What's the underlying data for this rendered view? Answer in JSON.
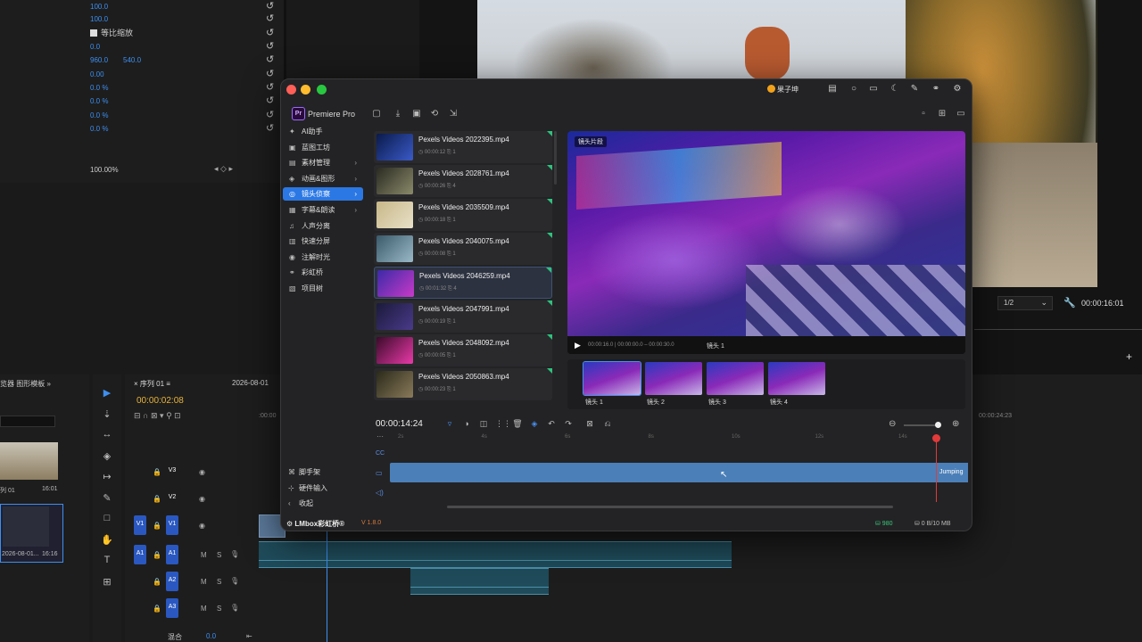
{
  "effect_controls": {
    "rows": [
      {
        "v1": "100.0",
        "v2": ""
      },
      {
        "v1": "100.0",
        "v2": ""
      },
      {
        "v1": "",
        "v2": ""
      },
      {
        "v1": "0.0",
        "v2": ""
      },
      {
        "v1": "960.0",
        "v2": "540.0"
      },
      {
        "v1": "0.00",
        "v2": ""
      },
      {
        "v1": "0.0 %",
        "v2": ""
      },
      {
        "v1": "0.0 %",
        "v2": ""
      },
      {
        "v1": "0.0 %",
        "v2": ""
      },
      {
        "v1": "0.0 %",
        "v2": ""
      }
    ],
    "uniform_scale_label": "等比缩放",
    "percent": "100.00%",
    "reset_glyph": "↺",
    "nav_glyph": "◂ ◇ ▸"
  },
  "program": {
    "zoom": "1/2",
    "timecode": "00:00:16:01",
    "plus": "+"
  },
  "project": {
    "tabs": "览器       图形模板  »",
    "items": [
      {
        "name": "列 01",
        "duration": "16:01"
      },
      {
        "name": "2026-08-01...",
        "duration": "16:16"
      }
    ]
  },
  "timeline": {
    "tab_label": "×  序列 01  ≡",
    "tab2_label": "2026-08-01",
    "timecode": "00:00:02:08",
    "tool_glyphs": "⊟ ∩ ⊠ ▾ ⚲ ⊡",
    "ruler_tc": ":00:00",
    "right_tc": "00:00:24:23",
    "video_tracks": [
      {
        "label": "V3"
      },
      {
        "label": "V2"
      },
      {
        "label": "V1"
      }
    ],
    "audio_tracks": [
      {
        "label": "A1"
      },
      {
        "label": "A2"
      },
      {
        "label": "A3"
      }
    ],
    "m_label": "M",
    "s_label": "S",
    "v1_src": "V1",
    "a1_src": "A1",
    "lock_glyph": "🔒",
    "eye_glyph": "◉",
    "mic_glyph": "🎙",
    "mix_label": "混合",
    "mix_value": "0.0",
    "mix_end": "⇤"
  },
  "tools": [
    "▶",
    "⇣",
    "↔",
    "◈",
    "↦",
    "✎",
    "□",
    "✋",
    "T",
    "⊞"
  ],
  "plugin": {
    "user": "果子坤",
    "app_logo": "Pr",
    "app_name": "Premiere Pro",
    "top_icons": [
      {
        "name": "layout-icon",
        "glyph": "▤"
      },
      {
        "name": "bulb-icon",
        "glyph": "○"
      },
      {
        "name": "chat-icon",
        "glyph": "▭"
      },
      {
        "name": "moon-icon",
        "glyph": "☾"
      },
      {
        "name": "pin-icon",
        "glyph": "✎"
      },
      {
        "name": "link-icon",
        "glyph": "⚭"
      },
      {
        "name": "settings-icon",
        "glyph": "⚙"
      }
    ],
    "toolbar_icons": [
      {
        "name": "grid-icon",
        "glyph": "▢"
      },
      {
        "name": "import-icon",
        "glyph": "⤓"
      },
      {
        "name": "image-icon",
        "glyph": "▣"
      },
      {
        "name": "sync-icon",
        "glyph": "⟲"
      },
      {
        "name": "export-icon",
        "glyph": "⇲"
      }
    ],
    "right_toolbar": [
      {
        "name": "save-icon",
        "glyph": "▫"
      },
      {
        "name": "add-icon",
        "glyph": "⊞"
      },
      {
        "name": "panel-icon",
        "glyph": "▭"
      }
    ],
    "nav": [
      {
        "icon": "✦",
        "label": "AI助手",
        "chev": ""
      },
      {
        "icon": "▣",
        "label": "蓝图工坊",
        "chev": ""
      },
      {
        "icon": "▤",
        "label": "素材管理",
        "chev": "›"
      },
      {
        "icon": "◈",
        "label": "动画&图形",
        "chev": "›"
      },
      {
        "icon": "◎",
        "label": "镜头侦察",
        "chev": "›"
      },
      {
        "icon": "▦",
        "label": "字幕&朗读",
        "chev": "›"
      },
      {
        "icon": "♫",
        "label": "人声分离",
        "chev": ""
      },
      {
        "icon": "▥",
        "label": "快速分屏",
        "chev": ""
      },
      {
        "icon": "◉",
        "label": "注解时光",
        "chev": ""
      },
      {
        "icon": "⚭",
        "label": "彩虹桥",
        "chev": ""
      },
      {
        "icon": "▧",
        "label": "项目树",
        "chev": ""
      }
    ],
    "bottom_nav": [
      {
        "icon": "⌘",
        "label": "脚手架"
      },
      {
        "icon": "⊹",
        "label": "硬件输入"
      },
      {
        "icon": "‹",
        "label": "收起"
      }
    ],
    "videos": [
      {
        "title": "Pexels Videos 2022395.mp4",
        "meta": "◷ 00:00:12  ⎘ 1",
        "c1": "#0a1a4a",
        "c2": "#3a5ac8"
      },
      {
        "title": "Pexels Videos 2028761.mp4",
        "meta": "◷ 00:00:26  ⎘ 4",
        "c1": "#2a2a22",
        "c2": "#8a8a6a"
      },
      {
        "title": "Pexels Videos 2035509.mp4",
        "meta": "◷ 00:00:18  ⎘ 1",
        "c1": "#c8b888",
        "c2": "#e8e0c8"
      },
      {
        "title": "Pexels Videos 2040075.mp4",
        "meta": "◷ 00:00:08  ⎘ 1",
        "c1": "#3a5a6a",
        "c2": "#9ab8c8"
      },
      {
        "title": "Pexels Videos 2046259.mp4",
        "meta": "◷ 00:01:32  ⎘ 4",
        "c1": "#3a2aa8",
        "c2": "#c83ac8"
      },
      {
        "title": "Pexels Videos 2047991.mp4",
        "meta": "◷ 00:00:19  ⎘ 1",
        "c1": "#1a1a3a",
        "c2": "#4a3a8a"
      },
      {
        "title": "Pexels Videos 2048092.mp4",
        "meta": "◷ 00:00:05  ⎘ 1",
        "c1": "#3a0a2a",
        "c2": "#e83aa8"
      },
      {
        "title": "Pexels Videos 2050863.mp4",
        "meta": "◷ 00:00:23  ⎘ 1",
        "c1": "#2a2a1a",
        "c2": "#8a7a5a"
      }
    ],
    "selected_video": 4,
    "preview": {
      "tag": "镜头片段",
      "time": "00:00:16.0 | 00:00:00.0 – 00:00:30.0",
      "shot": "镜头 1",
      "play_glyph": "▶"
    },
    "shots": [
      "镜头 1",
      "镜头 2",
      "镜头 3",
      "镜头 4"
    ],
    "selected_shot": 0,
    "edit": {
      "timecode": "00:00:14:24",
      "tool_glyphs": [
        "▿",
        "◑",
        "◫",
        "⋮⋮",
        "🗑",
        "◈",
        "↶",
        "↷",
        "⊠",
        "⎌"
      ],
      "zoom_out": "⊖",
      "zoom_in": "⊕",
      "ruler": [
        "2s",
        "4s",
        "6s",
        "8s",
        "10s",
        "12s",
        "14s"
      ],
      "ruler_dots": "···",
      "track_icons": [
        "CC",
        "▭",
        "◁)"
      ],
      "clip_label": "Jumping",
      "cursor": "↖"
    },
    "footer": {
      "logo": "⚙ LMbox彩虹桥®",
      "version": "V 1.8.0",
      "points": "⛁ 980",
      "size": "⛁ 0 B/10 MB"
    }
  }
}
